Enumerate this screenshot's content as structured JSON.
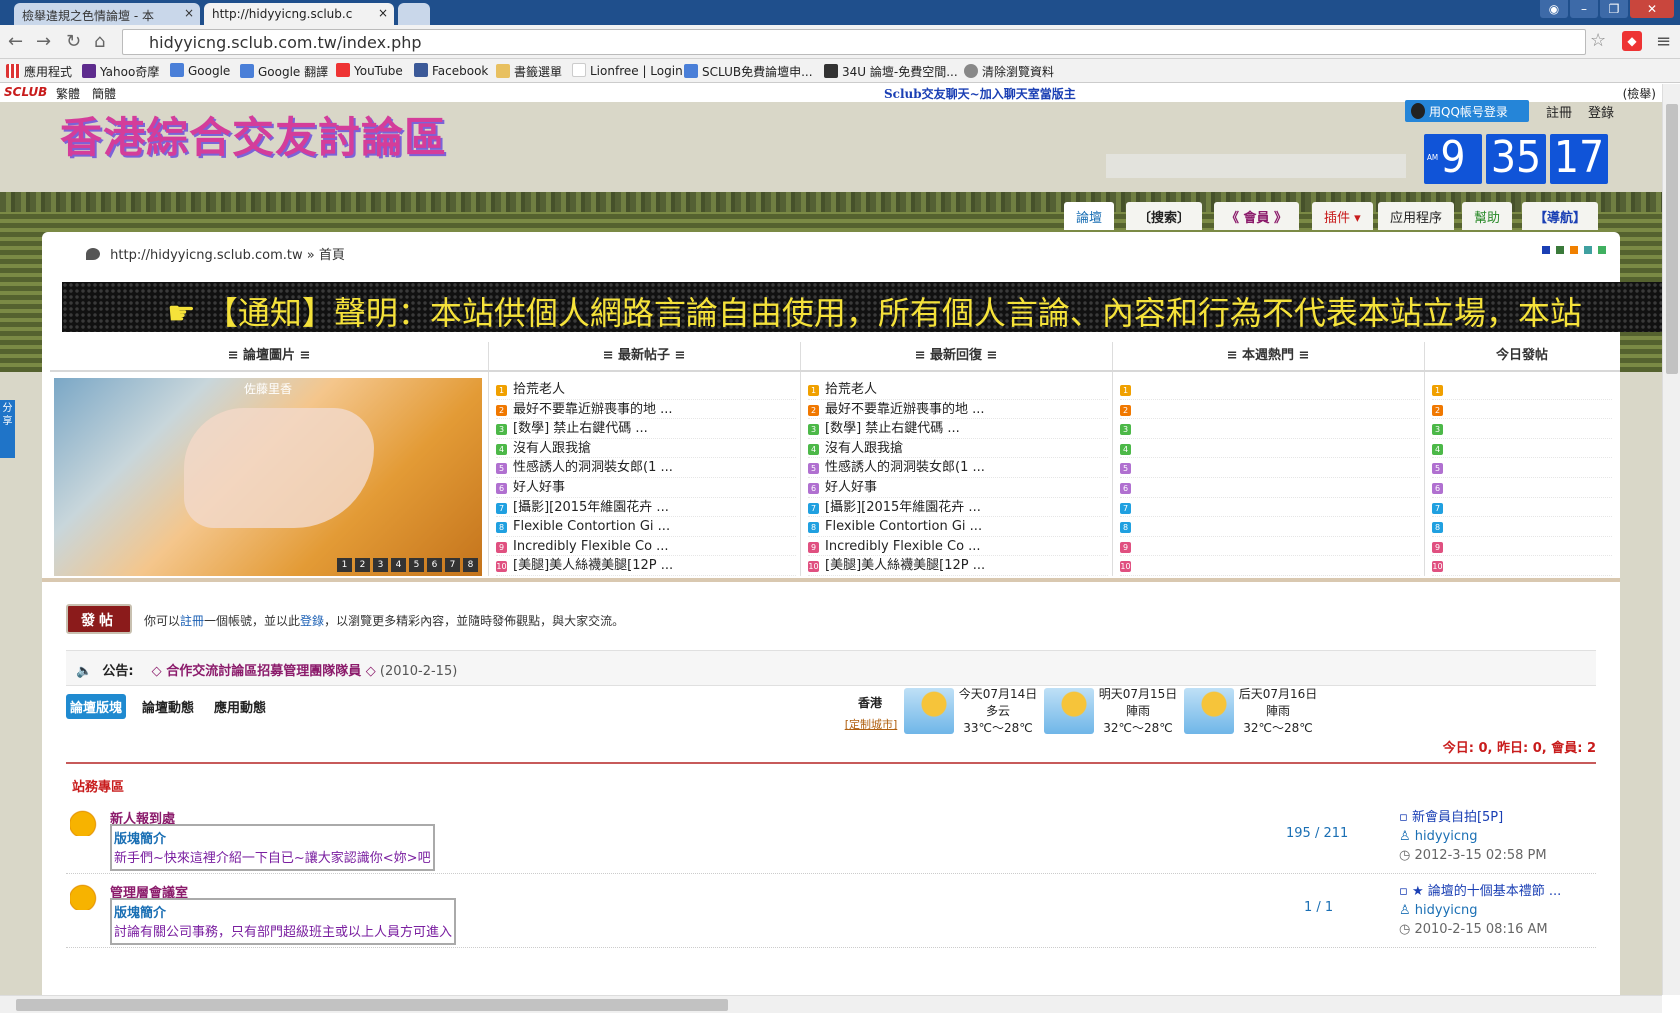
{
  "browser": {
    "tabs": [
      {
        "label": "檢舉違規之色情論壇 - 本",
        "active": false
      },
      {
        "label": "http://hidyyicng.sclub.c",
        "active": true
      }
    ],
    "url": "hidyyicng.sclub.com.tw/index.php",
    "bookmarks": [
      "應用程式",
      "Yahoo奇摩",
      "Google",
      "Google 翻譯",
      "YouTube",
      "Facebook",
      "書籤選單",
      "Lionfree | Login",
      "SCLUB免費論壇申...",
      "34U 論壇-免費空間...",
      "清除瀏覽資料"
    ]
  },
  "site": {
    "topstrip": {
      "brand": "SCLUB",
      "trad": "繁體",
      "simp": "簡體",
      "promo": "Sclub交友聊天~加入聊天室當版主",
      "report": "(檢舉)"
    },
    "logo_text": "香港綜合交友討論區",
    "qq_login": "用QQ帳号登录",
    "register": "註冊",
    "login": "登錄",
    "clock": {
      "h": "9",
      "m": "35",
      "s": "17",
      "ampm": "AM"
    },
    "nav": [
      "論壇",
      "〔搜索〕",
      "《 會員 》",
      "插件",
      "应用程序",
      "幫助",
      "【導航】"
    ],
    "breadcrumb": {
      "url": "http://hidyyicng.sclub.com.tw",
      "sep": "»",
      "home": "首頁"
    },
    "marquee": "☛ 【通知】聲明：本站供個人網路言論自由使用，所有個人言論、內容和行為不代表本站立場，本站"
  },
  "columns": {
    "headers": [
      "≡ 論壇圖片 ≡",
      "≡ 最新帖子 ≡",
      "≡ 最新回復 ≡",
      "≡ 本週熱門 ≡",
      "今日發帖"
    ],
    "photo_caption": "佐藤里香",
    "pager": [
      "1",
      "2",
      "3",
      "4",
      "5",
      "6",
      "7",
      "8"
    ],
    "latest_posts": [
      "拾荒老人",
      "最好不要靠近辦喪事的地 ...",
      "[数學] 禁止右鍵代碼 ...",
      "沒有人跟我搶",
      "性感誘人的洞洞裝女郎(1 ...",
      "好人好事",
      "[攝影][2015年維園花卉 ...",
      "Flexible Contortion Gi ...",
      "Incredibly Flexible Co ...",
      "[美腿]美人絲襪美腿[12P ..."
    ],
    "latest_replies": [
      "拾荒老人",
      "最好不要靠近辦喪事的地 ...",
      "[数學] 禁止右鍵代碼 ...",
      "沒有人跟我搶",
      "性感誘人的洞洞裝女郎(1 ...",
      "好人好事",
      "[攝影][2015年維園花卉 ...",
      "Flexible Contortion Gi ...",
      "Incredibly Flexible Co ...",
      "[美腿]美人絲襪美腿[12P ..."
    ],
    "rank_colors": [
      "#f0a000",
      "#f07800",
      "#4cb848",
      "#4cb848",
      "#b070d0",
      "#b070d0",
      "#20a0e0",
      "#20a0e0",
      "#e05080",
      "#e05080"
    ]
  },
  "post": {
    "button": "發帖",
    "msg_1": "你可以",
    "msg_register": "註冊",
    "msg_2": "一個帳號，並以此",
    "msg_login": "登錄",
    "msg_3": "，以瀏覽更多精彩內容，並隨時發佈觀點，與大家交流。"
  },
  "announcement": {
    "label": "公告:",
    "title": "◇ 合作交流討論區招募管理團隊隊員 ◇",
    "date": "(2010-2-15)"
  },
  "subtabs": [
    "論壇版塊",
    "論壇動態",
    "應用動態"
  ],
  "weather": {
    "city": "香港",
    "custom": "[定制城市]",
    "days": [
      {
        "day": "今天07月14日",
        "cond": "多云",
        "temp": "33℃～28℃"
      },
      {
        "day": "明天07月15日",
        "cond": "陣雨",
        "temp": "32℃～28℃"
      },
      {
        "day": "后天07月16日",
        "cond": "陣雨",
        "temp": "32℃～28℃"
      }
    ]
  },
  "stats": "今日: 0, 昨日: 0, 會員: 2",
  "section": "站務專區",
  "forums": [
    {
      "name": "新人報到處",
      "label": "版塊簡介",
      "desc": "新手們~快來這裡介紹一下自已~讓大家認識你<妳>吧",
      "count": "195 / 211",
      "last_title": "新會員自拍[5P]",
      "last_user": "hidyyicng",
      "last_date": "2012-3-15 02:58 PM"
    },
    {
      "name": "管理層會議室",
      "label": "版塊簡介",
      "desc": "討論有關公司事務，只有部門超級班主或以上人員方可進入",
      "count": "1 / 1",
      "last_title": "★ 論壇的十個基本禮節 ...",
      "last_user": "hidyyicng",
      "last_date": "2010-2-15 08:16 AM"
    }
  ],
  "side_share": "分享"
}
